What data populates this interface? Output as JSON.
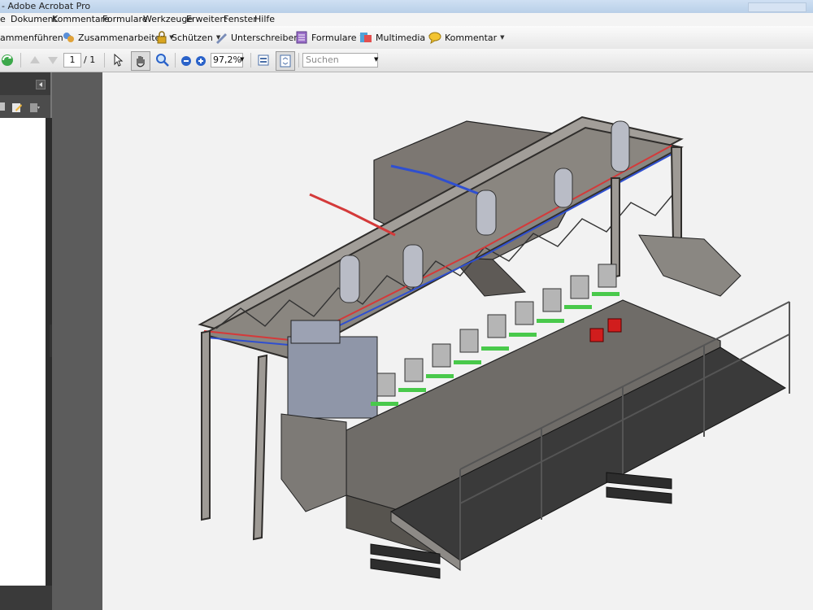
{
  "window": {
    "title": "- Adobe Acrobat Pro"
  },
  "menu": [
    "e",
    "Dokument",
    "Kommentare",
    "Formulare",
    "Werkzeuge",
    "Erweitert",
    "Fenster",
    "Hilfe"
  ],
  "toolbar": {
    "merge": "ammenführen",
    "collaborate": "Zusammenarbeiten",
    "secure": "Schützen",
    "sign": "Unterschreiben",
    "forms": "Formulare",
    "multimedia": "Multimedia",
    "comment": "Kommentar"
  },
  "nav": {
    "page_current": "1",
    "page_total": "/ 1",
    "zoom": "97,2%",
    "search_placeholder": "Suchen"
  },
  "colors": {
    "accent_blue": "#2a62c9",
    "toolbar_bg": "#efefef",
    "panel_dark": "#3b3b3b",
    "page_bg": "#f2f2f2",
    "machine_grey": "#6f6c68",
    "pipe_red": "#d43a3a",
    "pipe_blue": "#2f4fd0",
    "part_green": "#49c94b",
    "part_red": "#d11d1d"
  }
}
